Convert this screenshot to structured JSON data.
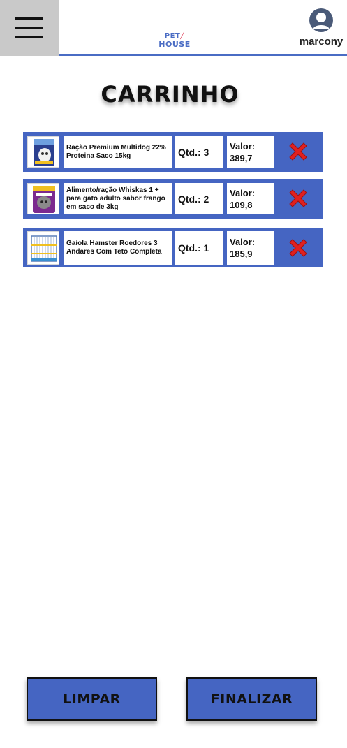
{
  "header": {
    "logo_line1": "PET",
    "logo_line2": "HOUSE",
    "username": "marcony",
    "menu_icon": "hamburger-icon",
    "user_icon": "user-avatar-icon"
  },
  "page": {
    "title": "CARRINHO"
  },
  "cart": {
    "qty_prefix": "Qtd.:",
    "value_label": "Valor:",
    "remove_icon": "red-x-icon",
    "items": [
      {
        "name": "Ração Premium Multidog 22% Proteina Saco 15kg",
        "qty": "Qtd.: 3",
        "value": "389,7",
        "thumb_icon": "dog-food-bag-icon"
      },
      {
        "name": "Alimento/ração Whiskas 1 + para gato adulto sabor frango em saco de 3kg",
        "qty": "Qtd.: 2",
        "value": "109,8",
        "thumb_icon": "cat-food-bag-icon"
      },
      {
        "name": "Gaiola Hamster Roedores 3 Andares Com Teto Completa",
        "qty": "Qtd.: 1",
        "value": "185,9",
        "thumb_icon": "hamster-cage-icon"
      }
    ]
  },
  "actions": {
    "clear_label": "LIMPAR",
    "finish_label": "FINALIZAR"
  },
  "colors": {
    "accent": "#4565c2",
    "remove": "#e02020",
    "menu_bg": "#c9c9c9"
  }
}
